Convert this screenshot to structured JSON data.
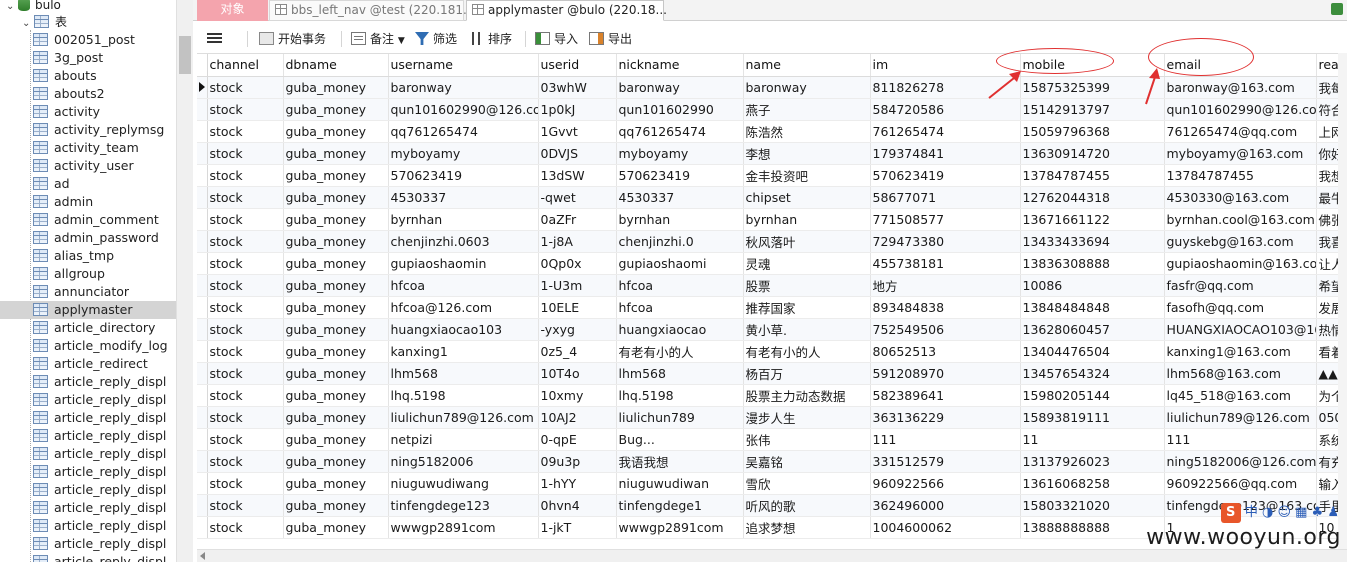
{
  "tree": {
    "database": "bulo",
    "group": "表",
    "tables": [
      "002051_post",
      "3g_post",
      "abouts",
      "abouts2",
      "activity",
      "activity_replymsg",
      "activity_team",
      "activity_user",
      "ad",
      "admin",
      "admin_comment",
      "admin_password",
      "alias_tmp",
      "allgroup",
      "annunciator",
      "applymaster",
      "article_directory",
      "article_modify_log",
      "article_redirect",
      "article_reply_displ",
      "article_reply_displ",
      "article_reply_displ",
      "article_reply_displ",
      "article_reply_displ",
      "article_reply_displ",
      "article_reply_displ",
      "article_reply_displ",
      "article_reply_displ",
      "article_reply_displ",
      "article_reply_displ"
    ],
    "selected_index": 15
  },
  "tabs": {
    "objects": "对象",
    "tab1": "bbs_left_nav @test (220.181...",
    "tab2": "applymaster @bulo (220.18..."
  },
  "toolbar": {
    "begin_tx": "开始事务",
    "memo": "备注",
    "filter": "筛选",
    "sort": "排序",
    "import": "导入",
    "export": "导出"
  },
  "grid": {
    "columns": [
      "channel",
      "dbname",
      "username",
      "userid",
      "nickname",
      "name",
      "im",
      "mobile",
      "email",
      "reas"
    ],
    "rows": [
      [
        "stock",
        "guba_money",
        "baronway",
        "03whW",
        "baronway",
        "baronway",
        "811826278",
        "15875325399",
        "baronway@163.com",
        "我每"
      ],
      [
        "stock",
        "guba_money",
        "qun101602990@126.com",
        "1p0kJ",
        "qun101602990",
        "燕子",
        "584720586",
        "15142913797",
        "qun101602990@126.com",
        "符合"
      ],
      [
        "stock",
        "guba_money",
        "qq761265474",
        "1Gvvt",
        "qq761265474",
        "陈浩然",
        "761265474",
        "15059796368",
        "761265474@qq.com",
        "上网"
      ],
      [
        "stock",
        "guba_money",
        "myboyamy",
        "0DVJS",
        "myboyamy",
        "李想",
        "179374841",
        "13630914720",
        "myboyamy@163.com",
        "你好"
      ],
      [
        "stock",
        "guba_money",
        "570623419",
        "13dSW",
        "570623419",
        "金丰投资吧",
        "570623419",
        "13784787455",
        "13784787455",
        "我想"
      ],
      [
        "stock",
        "guba_money",
        "4530337",
        "-qwet",
        "4530337",
        "chipset",
        "58677071",
        "12762044318",
        "4530330@163.com",
        "最牛"
      ],
      [
        "stock",
        "guba_money",
        "byrnhan",
        "0aZFr",
        "byrnhan",
        "byrnhan",
        "771508577",
        "13671661122",
        "byrnhan.cool@163.com",
        "佛张"
      ],
      [
        "stock",
        "guba_money",
        "chenjinzhi.0603",
        "1-j8A",
        "chenjinzhi.0",
        "秋风落叶",
        "729473380",
        "13433433694",
        "guyskebg@163.com",
        "我喜"
      ],
      [
        "stock",
        "guba_money",
        "gupiaoshaomin",
        "0Qp0x",
        "gupiaoshaomi",
        "灵魂",
        "455738181",
        "13836308888",
        "gupiaoshaomin@163.com",
        "让人"
      ],
      [
        "stock",
        "guba_money",
        "hfcoa",
        "1-U3m",
        "hfcoa",
        "股票",
        "地方",
        "10086",
        "fasfr@qq.com",
        "希望"
      ],
      [
        "stock",
        "guba_money",
        "hfcoa@126.com",
        "10ELE",
        "hfcoa",
        "推荐国家",
        "893484838",
        "13848484848",
        "fasofh@qq.com",
        "发展"
      ],
      [
        "stock",
        "guba_money",
        "huangxiaocao103",
        "-yxyg",
        "huangxiaocao",
        "黄小草.",
        "752549506",
        "13628060457",
        "HUANGXIAOCAO103@16",
        "热情"
      ],
      [
        "stock",
        "guba_money",
        "kanxing1",
        "0z5_4",
        "有老有小的人",
        "有老有小的人",
        "80652513",
        "13404476504",
        "kanxing1@163.com",
        "看着"
      ],
      [
        "stock",
        "guba_money",
        "lhm568",
        "10T4o",
        "lhm568",
        "杨百万",
        "591208970",
        "13457654324",
        "lhm568@163.com",
        "▲▲"
      ],
      [
        "stock",
        "guba_money",
        "lhq.5198",
        "10xmy",
        "lhq.5198",
        "股票主力动态数据",
        "582389641",
        "15980205144",
        "lq45_518@163.com",
        "为个"
      ],
      [
        "stock",
        "guba_money",
        "liulichun789@126.com",
        "10AJ2",
        "liulichun789",
        "漫步人生",
        "363136229",
        "15893819111",
        "liulichun789@126.com",
        "050"
      ],
      [
        "stock",
        "guba_money",
        "netpizi",
        "0-qpE",
        "Bug...",
        "张伟",
        "111",
        "11",
        "111",
        "系统"
      ],
      [
        "stock",
        "guba_money",
        "ning5182006",
        "09u3p",
        "我语我想",
        "吴嘉铭",
        "331512579",
        "13137926023",
        "ning5182006@126.com",
        "有充"
      ],
      [
        "stock",
        "guba_money",
        "niuguwudiwang",
        "1-hYY",
        "niuguwudiwan",
        "雪欣",
        "960922566",
        "13616068258",
        "960922566@qq.com",
        "输入"
      ],
      [
        "stock",
        "guba_money",
        "tinfengdege123",
        "0hvn4",
        "tinfengdege1",
        "听风的歌",
        "362496000",
        "15803321020",
        "tinfengdege123@163.com",
        "手里"
      ],
      [
        "stock",
        "guba_money",
        "wwwgp2891com",
        "1-jkT",
        "wwwgp2891com",
        "追求梦想",
        "1004600062",
        "13888888888",
        "1",
        "10"
      ]
    ]
  },
  "watermark": {
    "url": "www.wooyun.org",
    "ime": "中 ◑ ☺ ▦ ♣ ♟"
  },
  "colors": {
    "annotation": "#e03030",
    "objects_tab": "#f4a4ad"
  }
}
